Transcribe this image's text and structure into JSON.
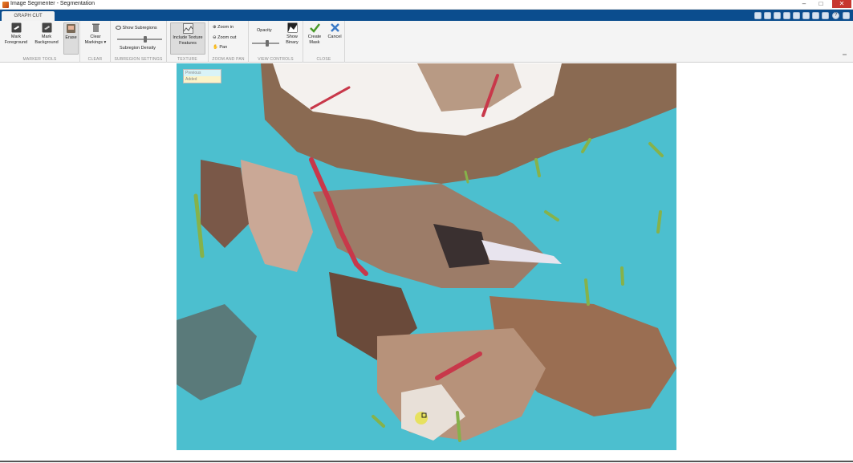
{
  "window": {
    "title": "Image Segmenter - Segmentation",
    "min_glyph": "–",
    "max_glyph": "□",
    "close_glyph": "✕"
  },
  "tabs": {
    "active": "GRAPH CUT"
  },
  "quick_access": {
    "help_glyph": "?"
  },
  "ribbon": {
    "marker_tools": {
      "label": "MARKER TOOLS",
      "mark_foreground": [
        "Mark",
        "Foreground"
      ],
      "mark_background": [
        "Mark",
        "Background"
      ],
      "erase": "Erase"
    },
    "clear": {
      "label": "CLEAR",
      "clear_markings": [
        "Clear",
        "Markings ▾"
      ]
    },
    "subregion_settings": {
      "label": "SUBREGION SETTINGS",
      "show_subregions": "Show Subregions",
      "subregion_density": "Subregion Density"
    },
    "texture": {
      "label": "TEXTURE",
      "include_texture": [
        "Include Texture",
        "Features"
      ]
    },
    "zoom_and_pan": {
      "label": "ZOOM AND PAN",
      "zoom_in": "Zoom in",
      "zoom_out": "Zoom out",
      "pan": "Pan"
    },
    "view_controls": {
      "label": "VIEW CONTROLS",
      "opacity": "Opacity",
      "show_binary": [
        "Show",
        "Binary"
      ]
    },
    "close": {
      "label": "CLOSE",
      "create_mask": [
        "Create",
        "Mask"
      ],
      "cancel": "Cancel"
    },
    "collapse_glyph": "═"
  },
  "legend": {
    "row1": "Previous",
    "row2": "Added"
  },
  "colors": {
    "foreground_marker": "#86b24a",
    "background_marker": "#c8384a",
    "overlay": "#4cc4d4"
  }
}
